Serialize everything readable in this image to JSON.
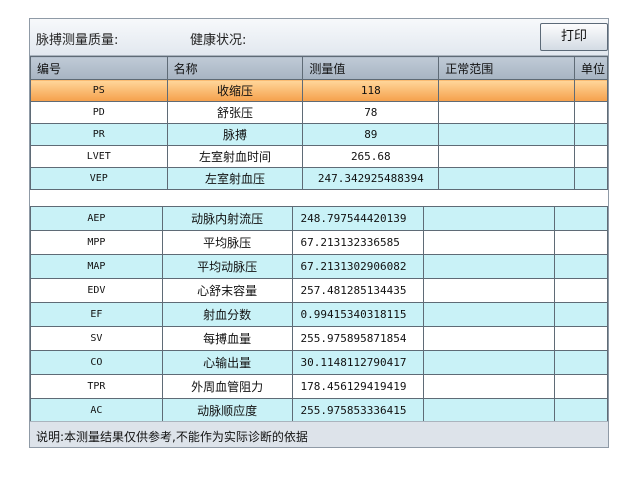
{
  "header": {
    "quality_label": "脉搏测量质量:",
    "health_label": "健康状况:",
    "print_label": "打印"
  },
  "table": {
    "columns": [
      "编号",
      "名称",
      "测量值",
      "正常范围",
      "单位"
    ],
    "rows": [
      {
        "code": "PS",
        "name": "收缩压",
        "value": "118",
        "range": "",
        "unit": ""
      },
      {
        "code": "PD",
        "name": "舒张压",
        "value": "78",
        "range": "",
        "unit": ""
      },
      {
        "code": "PR",
        "name": "脉搏",
        "value": "89",
        "range": "",
        "unit": ""
      },
      {
        "code": "LVET",
        "name": "左室射血时间",
        "value": "265.68",
        "range": "",
        "unit": ""
      },
      {
        "code": "VEP",
        "name": "左室射血压",
        "value": "247.342925488394",
        "range": "",
        "unit": ""
      },
      {
        "code": "AEP",
        "name": "动脉内射流压",
        "value": "248.797544420139",
        "range": "",
        "unit": ""
      },
      {
        "code": "MPP",
        "name": "平均脉压",
        "value": "67.213132336585",
        "range": "",
        "unit": ""
      },
      {
        "code": "MAP",
        "name": "平均动脉压",
        "value": "67.2131302906082",
        "range": "",
        "unit": ""
      },
      {
        "code": "EDV",
        "name": "心舒末容量",
        "value": "257.481285134435",
        "range": "",
        "unit": ""
      },
      {
        "code": "EF",
        "name": "射血分数",
        "value": "0.99415340318115",
        "range": "",
        "unit": ""
      },
      {
        "code": "SV",
        "name": "每搏血量",
        "value": "255.975895871854",
        "range": "",
        "unit": ""
      },
      {
        "code": "CO",
        "name": "心输出量",
        "value": "30.1148112790417",
        "range": "",
        "unit": ""
      },
      {
        "code": "TPR",
        "name": "外周血管阻力",
        "value": "178.456129419419",
        "range": "",
        "unit": ""
      },
      {
        "code": "AC",
        "name": "动脉顺应度",
        "value": "255.975853336415",
        "range": "",
        "unit": ""
      }
    ]
  },
  "footer": {
    "note": "说明:本测量结果仅供参考,不能作为实际诊断的依据"
  },
  "colors": {
    "selected_row": "#f5a04b",
    "cyan_row": "#c9f2f7",
    "header_bg": "#a7b4c2"
  }
}
